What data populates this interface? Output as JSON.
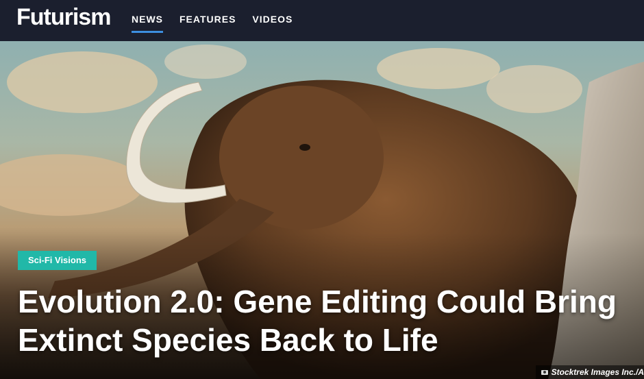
{
  "header": {
    "logo": "Futurism",
    "nav": [
      {
        "label": "NEWS",
        "active": true
      },
      {
        "label": "FEATURES",
        "active": false
      },
      {
        "label": "VIDEOS",
        "active": false
      }
    ]
  },
  "hero": {
    "tag": "Sci-Fi Visions",
    "headline": "Evolution 2.0: Gene Editing Could Bring Extinct Species Back to Life",
    "credit": "Stocktrek Images Inc./A",
    "image_subject": "woolly-mammoth",
    "tag_color": "#21b8a8",
    "accent_color": "#3d8fe0"
  }
}
